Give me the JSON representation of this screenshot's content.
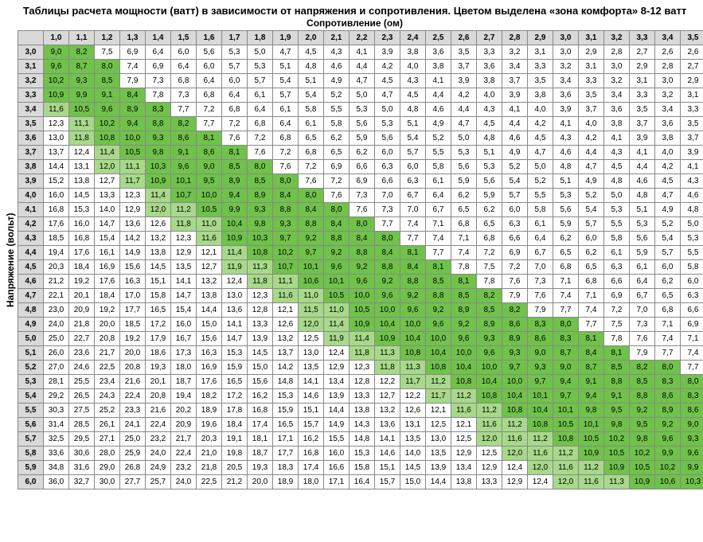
{
  "title": "Таблицы расчета мощности (ватт) в зависимости от напряжения и сопротивления. Цветом выделена «зона комфорта» 8-12 ватт",
  "subtitle": "Сопротивление (ом)",
  "ylabel": "Напряжение (вольт)",
  "chart_data": {
    "type": "table",
    "xlabel": "Сопротивление (ом)",
    "ylabel": "Напряжение (вольт)",
    "comfort_zone": [
      8,
      12
    ],
    "columns": [
      "1,0",
      "1,1",
      "1,2",
      "1,3",
      "1,4",
      "1,5",
      "1,6",
      "1,7",
      "1,8",
      "1,9",
      "2,0",
      "2,1",
      "2,2",
      "2,3",
      "2,4",
      "2,5",
      "2,6",
      "2,7",
      "2,8",
      "2,9",
      "3,0",
      "3,1",
      "3,2",
      "3,3",
      "3,4",
      "3,5"
    ],
    "rows": [
      "3,0",
      "3,1",
      "3,2",
      "3,3",
      "3,4",
      "3,5",
      "3,6",
      "3,7",
      "3,8",
      "3,9",
      "4,0",
      "4,1",
      "4,2",
      "4,3",
      "4,4",
      "4,5",
      "4,6",
      "4,7",
      "4,8",
      "4,9",
      "5,0",
      "5,1",
      "5,2",
      "5,3",
      "5,4",
      "5,5",
      "5,6",
      "5,7",
      "5,8",
      "5,9",
      "6,0"
    ],
    "cells": [
      [
        "9,0",
        "8,2",
        "7,5",
        "6,9",
        "6,4",
        "6,0",
        "5,6",
        "5,3",
        "5,0",
        "4,7",
        "4,5",
        "4,3",
        "4,1",
        "3,9",
        "3,8",
        "3,6",
        "3,5",
        "3,3",
        "3,2",
        "3,1",
        "3,0",
        "2,9",
        "2,8",
        "2,7",
        "2,6",
        "2,6"
      ],
      [
        "9,6",
        "8,7",
        "8,0",
        "7,4",
        "6,9",
        "6,4",
        "6,0",
        "5,7",
        "5,3",
        "5,1",
        "4,8",
        "4,6",
        "4,4",
        "4,2",
        "4,0",
        "3,8",
        "3,7",
        "3,6",
        "3,4",
        "3,3",
        "3,2",
        "3,1",
        "3,0",
        "2,9",
        "2,8",
        "2,7"
      ],
      [
        "10,2",
        "9,3",
        "8,5",
        "7,9",
        "7,3",
        "6,8",
        "6,4",
        "6,0",
        "5,7",
        "5,4",
        "5,1",
        "4,9",
        "4,7",
        "4,5",
        "4,3",
        "4,1",
        "3,9",
        "3,8",
        "3,7",
        "3,5",
        "3,4",
        "3,3",
        "3,2",
        "3,1",
        "3,0",
        "2,9"
      ],
      [
        "10,9",
        "9,9",
        "9,1",
        "8,4",
        "7,8",
        "7,3",
        "6,8",
        "6,4",
        "6,1",
        "5,7",
        "5,4",
        "5,2",
        "5,0",
        "4,7",
        "4,5",
        "4,4",
        "4,2",
        "4,0",
        "3,9",
        "3,8",
        "3,6",
        "3,5",
        "3,4",
        "3,3",
        "3,2",
        "3,1"
      ],
      [
        "11,6",
        "10,5",
        "9,6",
        "8,9",
        "8,3",
        "7,7",
        "7,2",
        "6,8",
        "6,4",
        "6,1",
        "5,8",
        "5,5",
        "5,3",
        "5,0",
        "4,8",
        "4,6",
        "4,4",
        "4,3",
        "4,1",
        "4,0",
        "3,9",
        "3,7",
        "3,6",
        "3,5",
        "3,4",
        "3,3"
      ],
      [
        "12,3",
        "11,1",
        "10,2",
        "9,4",
        "8,8",
        "8,2",
        "7,7",
        "7,2",
        "6,8",
        "6,4",
        "6,1",
        "5,8",
        "5,6",
        "5,3",
        "5,1",
        "4,9",
        "4,7",
        "4,5",
        "4,4",
        "4,2",
        "4,1",
        "4,0",
        "3,8",
        "3,7",
        "3,6",
        "3,5"
      ],
      [
        "13,0",
        "11,8",
        "10,8",
        "10,0",
        "9,3",
        "8,6",
        "8,1",
        "7,6",
        "7,2",
        "6,8",
        "6,5",
        "6,2",
        "5,9",
        "5,6",
        "5,4",
        "5,2",
        "5,0",
        "4,8",
        "4,6",
        "4,5",
        "4,3",
        "4,2",
        "4,1",
        "3,9",
        "3,8",
        "3,7"
      ],
      [
        "13,7",
        "12,4",
        "11,4",
        "10,5",
        "9,8",
        "9,1",
        "8,6",
        "8,1",
        "7,6",
        "7,2",
        "6,8",
        "6,5",
        "6,2",
        "6,0",
        "5,7",
        "5,5",
        "5,3",
        "5,1",
        "4,9",
        "4,7",
        "4,6",
        "4,4",
        "4,3",
        "4,1",
        "4,0",
        "3,9"
      ],
      [
        "14,4",
        "13,1",
        "12,0",
        "11,1",
        "10,3",
        "9,6",
        "9,0",
        "8,5",
        "8,0",
        "7,6",
        "7,2",
        "6,9",
        "6,6",
        "6,3",
        "6,0",
        "5,8",
        "5,6",
        "5,3",
        "5,2",
        "5,0",
        "4,8",
        "4,7",
        "4,5",
        "4,4",
        "4,2",
        "4,1"
      ],
      [
        "15,2",
        "13,8",
        "12,7",
        "11,7",
        "10,9",
        "10,1",
        "9,5",
        "8,9",
        "8,5",
        "8,0",
        "7,6",
        "7,2",
        "6,9",
        "6,6",
        "6,3",
        "6,1",
        "5,9",
        "5,6",
        "5,4",
        "5,2",
        "5,1",
        "4,9",
        "4,8",
        "4,6",
        "4,5",
        "4,3"
      ],
      [
        "16,0",
        "14,5",
        "13,3",
        "12,3",
        "11,4",
        "10,7",
        "10,0",
        "9,4",
        "8,9",
        "8,4",
        "8,0",
        "7,6",
        "7,3",
        "7,0",
        "6,7",
        "6,4",
        "6,2",
        "5,9",
        "5,7",
        "5,5",
        "5,3",
        "5,2",
        "5,0",
        "4,8",
        "4,7",
        "4,6"
      ],
      [
        "16,8",
        "15,3",
        "14,0",
        "12,9",
        "12,0",
        "11,2",
        "10,5",
        "9,9",
        "9,3",
        "8,8",
        "8,4",
        "8,0",
        "7,6",
        "7,3",
        "7,0",
        "6,7",
        "6,5",
        "6,2",
        "6,0",
        "5,8",
        "5,6",
        "5,4",
        "5,3",
        "5,1",
        "4,9",
        "4,8"
      ],
      [
        "17,6",
        "16,0",
        "14,7",
        "13,6",
        "12,6",
        "11,8",
        "11,0",
        "10,4",
        "9,8",
        "9,3",
        "8,8",
        "8,4",
        "8,0",
        "7,7",
        "7,4",
        "7,1",
        "6,8",
        "6,5",
        "6,3",
        "6,1",
        "5,9",
        "5,7",
        "5,5",
        "5,3",
        "5,2",
        "5,0"
      ],
      [
        "18,5",
        "16,8",
        "15,4",
        "14,2",
        "13,2",
        "12,3",
        "11,6",
        "10,9",
        "10,3",
        "9,7",
        "9,2",
        "8,8",
        "8,4",
        "8,0",
        "7,7",
        "7,4",
        "7,1",
        "6,8",
        "6,6",
        "6,4",
        "6,2",
        "6,0",
        "5,8",
        "5,6",
        "5,4",
        "5,3"
      ],
      [
        "19,4",
        "17,6",
        "16,1",
        "14,9",
        "13,8",
        "12,9",
        "12,1",
        "11,4",
        "10,8",
        "10,2",
        "9,7",
        "9,2",
        "8,8",
        "8,4",
        "8,1",
        "7,7",
        "7,4",
        "7,2",
        "6,9",
        "6,7",
        "6,5",
        "6,2",
        "6,1",
        "5,9",
        "5,7",
        "5,5"
      ],
      [
        "20,3",
        "18,4",
        "16,9",
        "15,6",
        "14,5",
        "13,5",
        "12,7",
        "11,9",
        "11,3",
        "10,7",
        "10,1",
        "9,6",
        "9,2",
        "8,8",
        "8,4",
        "8,1",
        "7,8",
        "7,5",
        "7,2",
        "7,0",
        "6,8",
        "6,5",
        "6,3",
        "6,1",
        "6,0",
        "5,8"
      ],
      [
        "21,2",
        "19,2",
        "17,6",
        "16,3",
        "15,1",
        "14,1",
        "13,2",
        "12,4",
        "11,8",
        "11,1",
        "10,6",
        "10,1",
        "9,6",
        "9,2",
        "8,8",
        "8,5",
        "8,1",
        "7,8",
        "7,6",
        "7,3",
        "7,1",
        "6,8",
        "6,6",
        "6,4",
        "6,2",
        "6,0"
      ],
      [
        "22,1",
        "20,1",
        "18,4",
        "17,0",
        "15,8",
        "14,7",
        "13,8",
        "13,0",
        "12,3",
        "11,6",
        "11,0",
        "10,5",
        "10,0",
        "9,6",
        "9,2",
        "8,8",
        "8,5",
        "8,2",
        "7,9",
        "7,6",
        "7,4",
        "7,1",
        "6,9",
        "6,7",
        "6,5",
        "6,3"
      ],
      [
        "23,0",
        "20,9",
        "19,2",
        "17,7",
        "16,5",
        "15,4",
        "14,4",
        "13,6",
        "12,8",
        "12,1",
        "11,5",
        "11,0",
        "10,5",
        "10,0",
        "9,6",
        "9,2",
        "8,9",
        "8,5",
        "8,2",
        "7,9",
        "7,7",
        "7,4",
        "7,2",
        "7,0",
        "6,8",
        "6,6"
      ],
      [
        "24,0",
        "21,8",
        "20,0",
        "18,5",
        "17,2",
        "16,0",
        "15,0",
        "14,1",
        "13,3",
        "12,6",
        "12,0",
        "11,4",
        "10,9",
        "10,4",
        "10,0",
        "9,6",
        "9,2",
        "8,9",
        "8,6",
        "8,3",
        "8,0",
        "7,7",
        "7,5",
        "7,3",
        "7,1",
        "6,9"
      ],
      [
        "25,0",
        "22,7",
        "20,8",
        "19,2",
        "17,9",
        "16,7",
        "15,6",
        "14,7",
        "13,9",
        "13,2",
        "12,5",
        "11,9",
        "11,4",
        "10,9",
        "10,4",
        "10,0",
        "9,6",
        "9,3",
        "8,9",
        "8,6",
        "8,3",
        "8,1",
        "7,8",
        "7,6",
        "7,4",
        "7,1"
      ],
      [
        "26,0",
        "23,6",
        "21,7",
        "20,0",
        "18,6",
        "17,3",
        "16,3",
        "15,3",
        "14,5",
        "13,7",
        "13,0",
        "12,4",
        "11,8",
        "11,3",
        "10,8",
        "10,4",
        "10,0",
        "9,6",
        "9,3",
        "9,0",
        "8,7",
        "8,4",
        "8,1",
        "7,9",
        "7,7",
        "7,4"
      ],
      [
        "27,0",
        "24,6",
        "22,5",
        "20,8",
        "19,3",
        "18,0",
        "16,9",
        "15,9",
        "15,0",
        "14,2",
        "13,5",
        "12,9",
        "12,3",
        "11,8",
        "11,3",
        "10,8",
        "10,4",
        "10,0",
        "9,7",
        "9,3",
        "9,0",
        "8,7",
        "8,5",
        "8,2",
        "8,0",
        "7,7"
      ],
      [
        "28,1",
        "25,5",
        "23,4",
        "21,6",
        "20,1",
        "18,7",
        "17,6",
        "16,5",
        "15,6",
        "14,8",
        "14,1",
        "13,4",
        "12,8",
        "12,2",
        "11,7",
        "11,2",
        "10,8",
        "10,4",
        "10,0",
        "9,7",
        "9,4",
        "9,1",
        "8,8",
        "8,5",
        "8,3",
        "8,0"
      ],
      [
        "29,2",
        "26,5",
        "24,3",
        "22,4",
        "20,8",
        "19,4",
        "18,2",
        "17,2",
        "16,2",
        "15,3",
        "14,6",
        "13,9",
        "13,3",
        "12,7",
        "12,2",
        "11,7",
        "11,2",
        "10,8",
        "10,4",
        "10,1",
        "9,7",
        "9,4",
        "9,1",
        "8,8",
        "8,6",
        "8,3"
      ],
      [
        "30,3",
        "27,5",
        "25,2",
        "23,3",
        "21,6",
        "20,2",
        "18,9",
        "17,8",
        "16,8",
        "15,9",
        "15,1",
        "14,4",
        "13,8",
        "13,2",
        "12,6",
        "12,1",
        "11,6",
        "11,2",
        "10,8",
        "10,4",
        "10,1",
        "9,8",
        "9,5",
        "9,2",
        "8,9",
        "8,6"
      ],
      [
        "31,4",
        "28,5",
        "26,1",
        "24,1",
        "22,4",
        "20,9",
        "19,6",
        "18,4",
        "17,4",
        "16,5",
        "15,7",
        "14,9",
        "14,3",
        "13,6",
        "13,1",
        "12,5",
        "12,1",
        "11,6",
        "11,2",
        "10,8",
        "10,5",
        "10,1",
        "9,8",
        "9,5",
        "9,2",
        "9,0"
      ],
      [
        "32,5",
        "29,5",
        "27,1",
        "25,0",
        "23,2",
        "21,7",
        "20,3",
        "19,1",
        "18,1",
        "17,1",
        "16,2",
        "15,5",
        "14,8",
        "14,1",
        "13,5",
        "13,0",
        "12,5",
        "12,0",
        "11,6",
        "11,2",
        "10,8",
        "10,5",
        "10,2",
        "9,8",
        "9,6",
        "9,3"
      ],
      [
        "33,6",
        "30,6",
        "28,0",
        "25,9",
        "24,0",
        "22,4",
        "21,0",
        "19,8",
        "18,7",
        "17,7",
        "16,8",
        "16,0",
        "15,3",
        "14,6",
        "14,0",
        "13,5",
        "12,9",
        "12,5",
        "12,0",
        "11,6",
        "11,2",
        "10,9",
        "10,5",
        "10,2",
        "9,9",
        "9,6"
      ],
      [
        "34,8",
        "31,6",
        "29,0",
        "26,8",
        "24,9",
        "23,2",
        "21,8",
        "20,5",
        "19,3",
        "18,3",
        "17,4",
        "16,6",
        "15,8",
        "15,1",
        "14,5",
        "13,9",
        "13,4",
        "12,9",
        "12,4",
        "12,0",
        "11,6",
        "11,2",
        "10,9",
        "10,5",
        "10,2",
        "9,9"
      ],
      [
        "36,0",
        "32,7",
        "30,0",
        "27,7",
        "25,7",
        "24,0",
        "22,5",
        "21,2",
        "20,0",
        "18,9",
        "18,0",
        "17,1",
        "16,4",
        "15,7",
        "15,0",
        "14,4",
        "13,8",
        "13,3",
        "12,9",
        "12,4",
        "12,0",
        "11,6",
        "11,3",
        "10,9",
        "10,6",
        "10,3"
      ]
    ]
  }
}
